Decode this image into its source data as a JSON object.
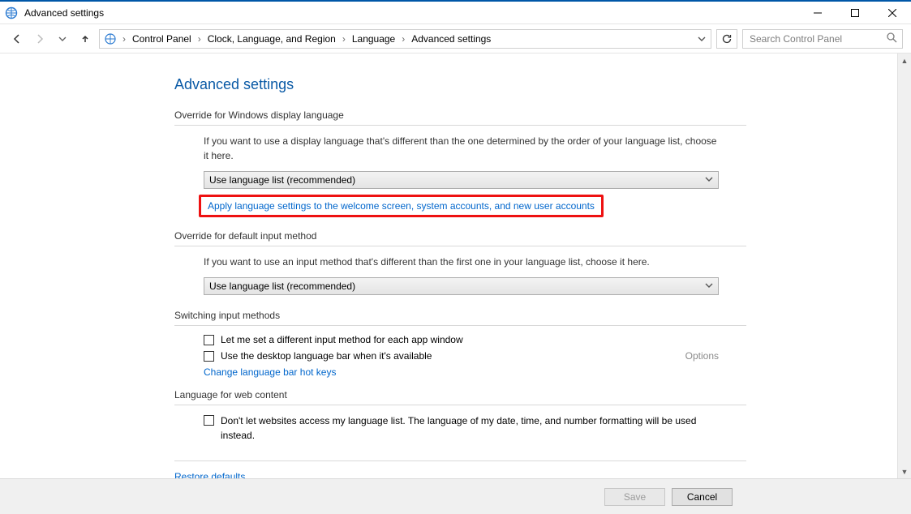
{
  "window": {
    "title": "Advanced settings"
  },
  "breadcrumbs": {
    "a": "Control Panel",
    "b": "Clock, Language, and Region",
    "c": "Language",
    "d": "Advanced settings"
  },
  "search": {
    "placeholder": "Search Control Panel"
  },
  "page": {
    "title": "Advanced settings",
    "section1": {
      "heading": "Override for Windows display language",
      "desc": "If you want to use a display language that's different than the one determined by the order of your language list, choose it here.",
      "dropdown": "Use language list (recommended)",
      "link": "Apply language settings to the welcome screen, system accounts, and new user accounts"
    },
    "section2": {
      "heading": "Override for default input method",
      "desc": "If you want to use an input method that's different than the first one in your language list, choose it here.",
      "dropdown": "Use language list (recommended)"
    },
    "section3": {
      "heading": "Switching input methods",
      "chk1": "Let me set a different input method for each app window",
      "chk2": "Use the desktop language bar when it's available",
      "options": "Options",
      "link": "Change language bar hot keys"
    },
    "section4": {
      "heading": "Language for web content",
      "chk": "Don't let websites access my language list. The language of my date, time, and number formatting will be used instead."
    },
    "restore": "Restore defaults"
  },
  "buttons": {
    "save": "Save",
    "cancel": "Cancel"
  }
}
